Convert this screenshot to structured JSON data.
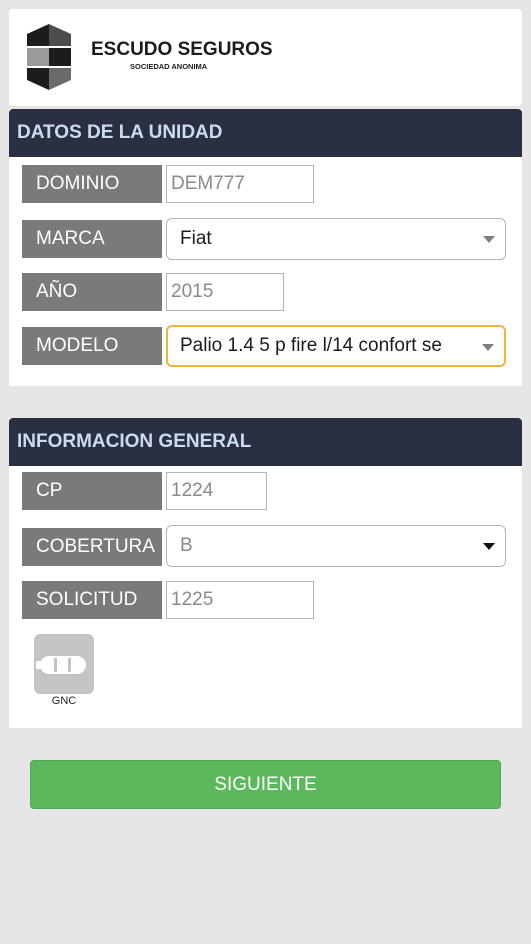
{
  "brand": {
    "name": "ESCUDO SEGUROS",
    "subtitle": "SOCIEDAD ANONIMA"
  },
  "unit_section": {
    "title": "DATOS DE LA UNIDAD",
    "dominio": {
      "label": "DOMINIO",
      "value": "DEM777"
    },
    "marca": {
      "label": "MARCA",
      "value": "Fiat"
    },
    "anio": {
      "label": "AÑO",
      "value": "2015"
    },
    "modelo": {
      "label": "MODELO",
      "value": "Palio 1.4 5 p fire l/14 confort se"
    }
  },
  "general_section": {
    "title": "INFORMACION GENERAL",
    "cp": {
      "label": "CP",
      "value": "1224"
    },
    "cobertura": {
      "label": "COBERTURA",
      "value": "B"
    },
    "solicitud": {
      "label": "SOLICITUD",
      "value": "1225"
    },
    "gnc": {
      "label": "GNC",
      "icon": "gas-cylinder-icon"
    }
  },
  "actions": {
    "next_label": "SIGUIENTE"
  },
  "colors": {
    "header_bg": "#2b2f42",
    "header_text": "#c9ddf0",
    "label_bg": "#7a7a7a",
    "accent_green": "#5cb85c",
    "focus_border": "#f0b440"
  }
}
